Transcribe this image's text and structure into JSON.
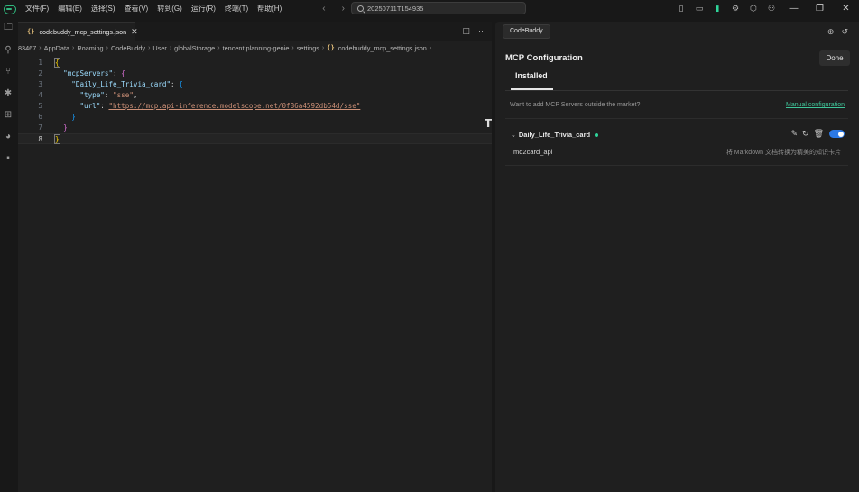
{
  "menu": [
    "文件(F)",
    "编辑(E)",
    "选择(S)",
    "查看(V)",
    "转到(G)",
    "运行(R)",
    "终端(T)",
    "帮助(H)"
  ],
  "search": {
    "value": "20250711T154935"
  },
  "editor": {
    "tab_label": "codebuddy_mcp_settings.json",
    "breadcrumb": [
      "83467",
      "AppData",
      "Roaming",
      "CodeBuddy",
      "User",
      "globalStorage",
      "tencent.planning-genie",
      "settings",
      "codebuddy_mcp_settings.json",
      "..."
    ],
    "lines": {
      "l1": "{",
      "l2_key": "\"mcpServers\"",
      "l2_brace": "{",
      "l3_key": "\"Daily_Life_Trivia_card\"",
      "l3_brace": "{",
      "l4_key": "\"type\"",
      "l4_val": "\"sse\"",
      "l5_key": "\"url\"",
      "l5_val": "\"https://mcp.api-inference.modelscope.net/0f86a4592db54d/sse\"",
      "l6": "}",
      "l7": "}",
      "l8": "}"
    },
    "line_numbers": [
      "1",
      "2",
      "3",
      "4",
      "5",
      "6",
      "7",
      "8"
    ]
  },
  "panel": {
    "tab_label": "CodeBuddy",
    "title": "MCP Configuration",
    "done_label": "Done",
    "installed_label": "Installed",
    "want_text": "Want to add MCP Servers outside the market?",
    "manual_link": "Manual configuration",
    "server": {
      "name": "Daily_Life_Trivia_card",
      "enabled": true,
      "tool_name": "md2card_api",
      "tool_desc": "将 Markdown 文档转换为精美的知识卡片"
    }
  },
  "colors": {
    "accent_green": "#2fd49a",
    "toggle_blue": "#2b78e4",
    "link_green": "#3fc69a"
  }
}
